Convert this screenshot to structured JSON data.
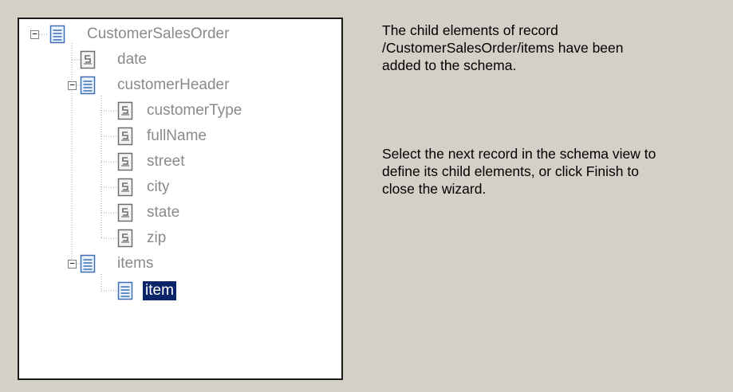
{
  "tree": {
    "nodes": [
      {
        "label": "CustomerSalesOrder",
        "icon": "record-icon"
      },
      {
        "label": "date",
        "icon": "field-icon"
      },
      {
        "label": "customerHeader",
        "icon": "record-icon"
      },
      {
        "label": "customerType",
        "icon": "field-icon"
      },
      {
        "label": "fullName",
        "icon": "field-icon"
      },
      {
        "label": "street",
        "icon": "field-icon"
      },
      {
        "label": "city",
        "icon": "field-icon"
      },
      {
        "label": "state",
        "icon": "field-icon"
      },
      {
        "label": "zip",
        "icon": "field-icon"
      },
      {
        "label": "items",
        "icon": "record-icon"
      },
      {
        "label": "item",
        "icon": "record-icon",
        "selected": true
      }
    ],
    "expander_symbol": "−",
    "selection_color": "#0a246a"
  },
  "messages": {
    "status": "The child elements of record\n/CustomerSalesOrder/items have been\nadded to the schema.",
    "instruction": "Select the next record in the schema view to\ndefine its child elements, or click Finish to\nclose the wizard."
  }
}
